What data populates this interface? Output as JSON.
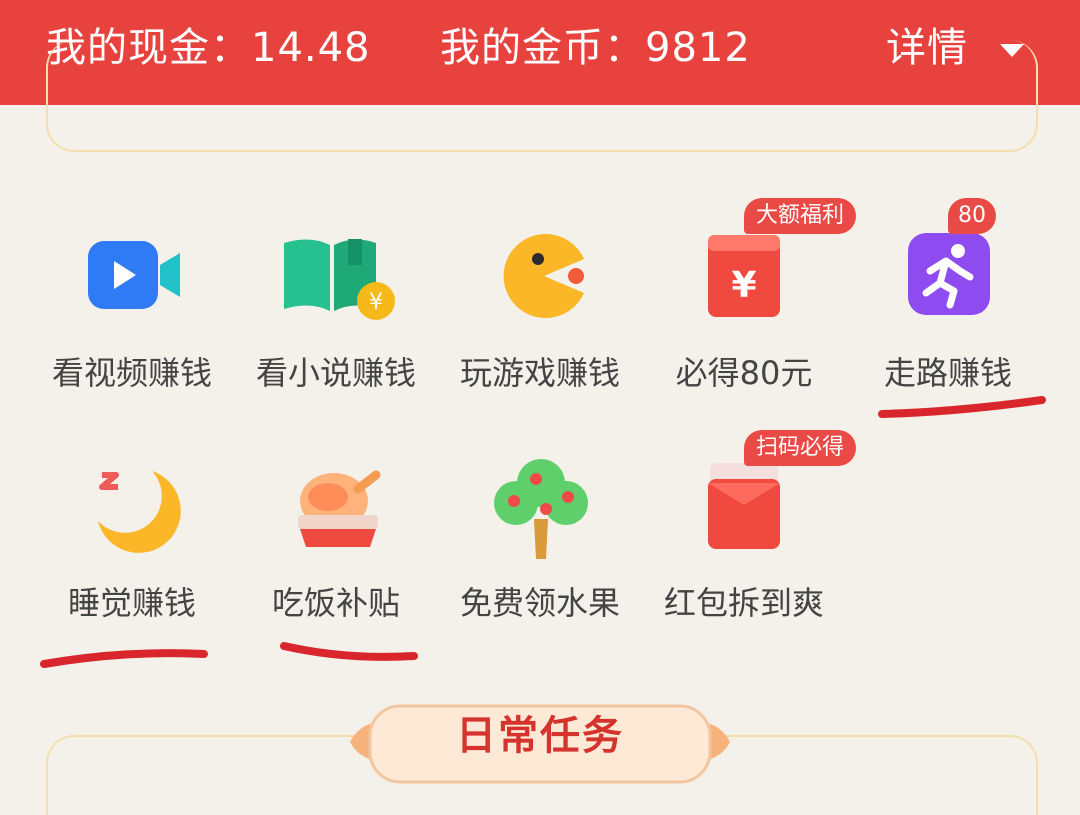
{
  "header": {
    "cash_label": "我的现金：14.48",
    "coin_label": "我的金币：9812",
    "detail_label": "详情"
  },
  "items": [
    {
      "label": "看视频赚钱",
      "icon": "video-camera-icon"
    },
    {
      "label": "看小说赚钱",
      "icon": "book-coin-icon"
    },
    {
      "label": "玩游戏赚钱",
      "icon": "pacman-icon"
    },
    {
      "label": "必得80元",
      "icon": "red-envelope-yuan-icon",
      "badge": "大额福利"
    },
    {
      "label": "走路赚钱",
      "icon": "running-person-icon",
      "badge": "80"
    },
    {
      "label": "睡觉赚钱",
      "icon": "moon-sleep-icon"
    },
    {
      "label": "吃饭补贴",
      "icon": "roast-chicken-icon"
    },
    {
      "label": "免费领水果",
      "icon": "fruit-tree-icon"
    },
    {
      "label": "红包拆到爽",
      "icon": "red-envelope-open-icon",
      "badge": "扫码必得"
    }
  ],
  "daily": {
    "title": "日常任务"
  },
  "colors": {
    "brand_red": "#e8423f",
    "badge_red": "#ea4a45",
    "background": "#f4f1ea",
    "annotation_red": "#d9262c"
  }
}
